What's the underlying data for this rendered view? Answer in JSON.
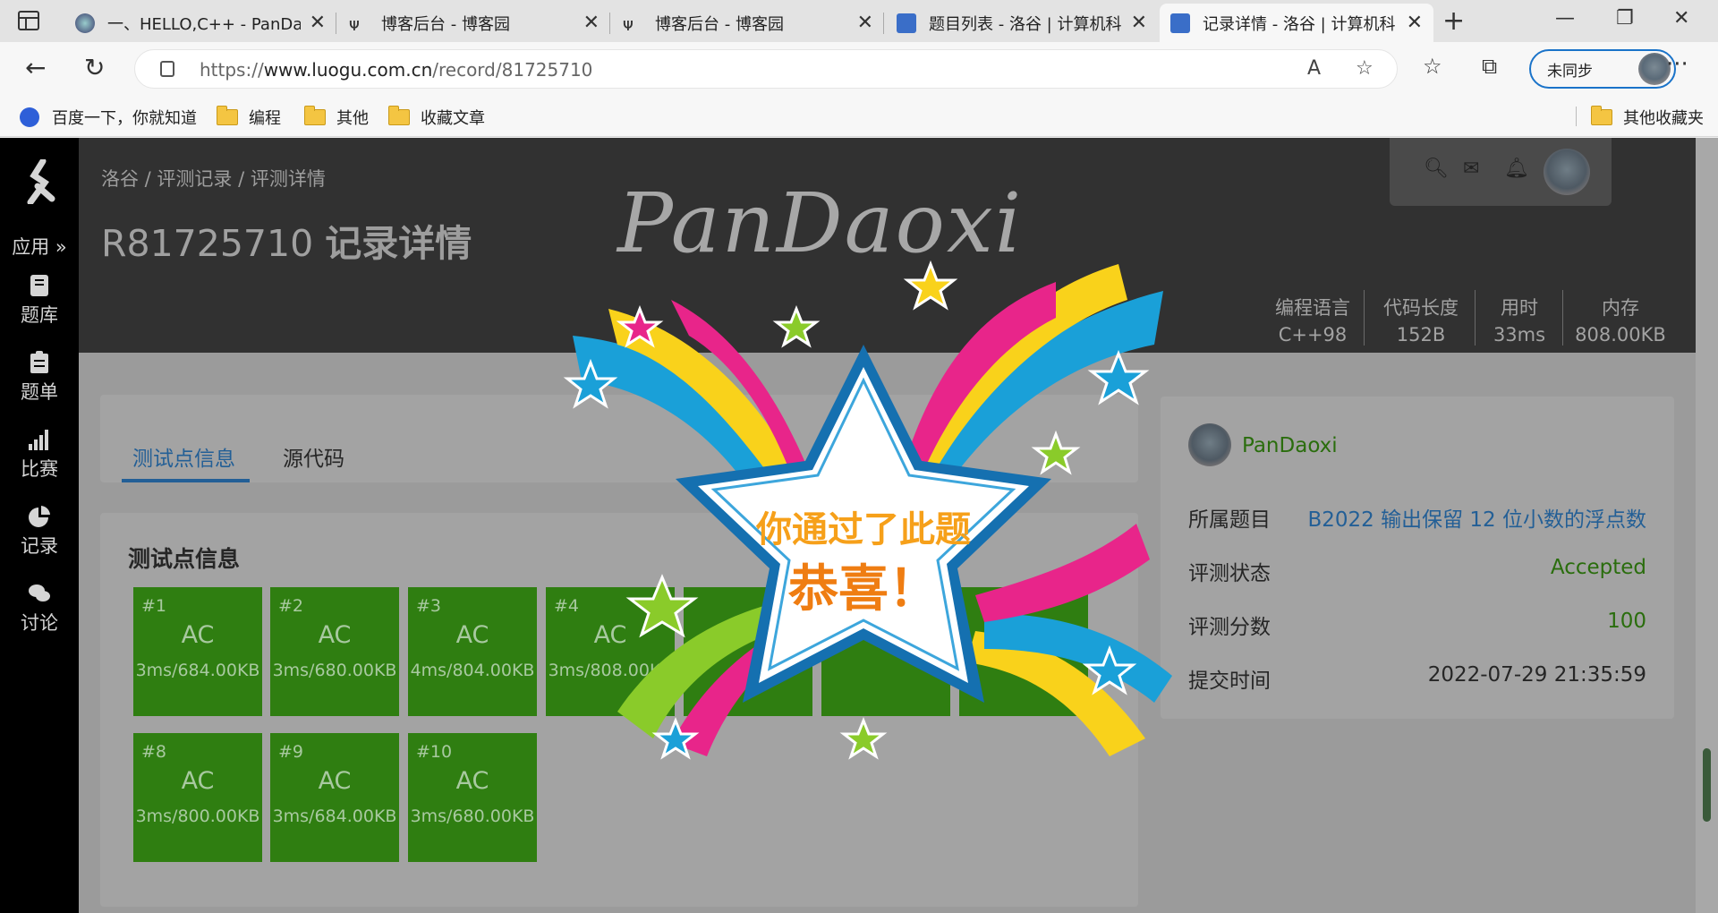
{
  "browser": {
    "tabs": [
      {
        "title": "一、HELLO,C++ - PanDao"
      },
      {
        "title": "博客后台 - 博客园"
      },
      {
        "title": "博客后台 - 博客园"
      },
      {
        "title": "题目列表 - 洛谷 | 计算机科"
      },
      {
        "title": "记录详情 - 洛谷 | 计算机科"
      }
    ],
    "url_prefix": "https://",
    "url_host": "www.luogu.com.cn",
    "url_path": "/record/81725710",
    "sync_label": "未同步",
    "bookmarks": [
      "百度一下，你就知道",
      "编程",
      "其他",
      "收藏文章"
    ],
    "other_bookmarks": "其他收藏夹"
  },
  "sidebar": {
    "apps_label": "应用 »",
    "items": [
      {
        "label": "题库",
        "icon": "book-icon"
      },
      {
        "label": "题单",
        "icon": "clipboard-icon"
      },
      {
        "label": "比赛",
        "icon": "bar-chart-icon"
      },
      {
        "label": "记录",
        "icon": "pie-chart-icon"
      },
      {
        "label": "讨论",
        "icon": "chat-icon"
      }
    ]
  },
  "header": {
    "breadcrumb": "洛谷 / 评测记录 / 评测详情",
    "record_id": "R81725710",
    "title": "记录详情",
    "stats": [
      {
        "label": "编程语言",
        "value": "C++98"
      },
      {
        "label": "代码长度",
        "value": "152B"
      },
      {
        "label": "用时",
        "value": "33ms"
      },
      {
        "label": "内存",
        "value": "808.00KB"
      }
    ]
  },
  "tabs": {
    "testcases": "测试点信息",
    "source": "源代码"
  },
  "testcases": {
    "title": "测试点信息",
    "cases": [
      {
        "id": "#1",
        "status": "AC",
        "detail": "3ms/684.00KB"
      },
      {
        "id": "#2",
        "status": "AC",
        "detail": "3ms/680.00KB"
      },
      {
        "id": "#3",
        "status": "AC",
        "detail": "4ms/804.00KB"
      },
      {
        "id": "#4",
        "status": "AC",
        "detail": "3ms/808.00KB"
      },
      {
        "id": "#8",
        "status": "AC",
        "detail": "3ms/800.00KB"
      },
      {
        "id": "#9",
        "status": "AC",
        "detail": "3ms/684.00KB"
      },
      {
        "id": "#10",
        "status": "AC",
        "detail": "3ms/680.00KB"
      }
    ]
  },
  "info": {
    "user": "PanDaoxi",
    "rows": [
      {
        "label": "所属题目",
        "value": "B2022 输出保留 12 位小数的浮点数",
        "color": "#235f96"
      },
      {
        "label": "评测状态",
        "value": "Accepted",
        "color": "#2a6d0d"
      },
      {
        "label": "评测分数",
        "value": "100",
        "color": "#2a6d0d"
      },
      {
        "label": "提交时间",
        "value": "2022-07-29 21:35:59",
        "color": "#262626"
      }
    ]
  },
  "overlay": {
    "watermark": "PanDaoxi",
    "line1": "你通过了此题",
    "line2": "恭喜！"
  },
  "colors": {
    "ac_green": "#2f7e11",
    "link_blue": "#235f96",
    "header_dark": "#313131"
  }
}
